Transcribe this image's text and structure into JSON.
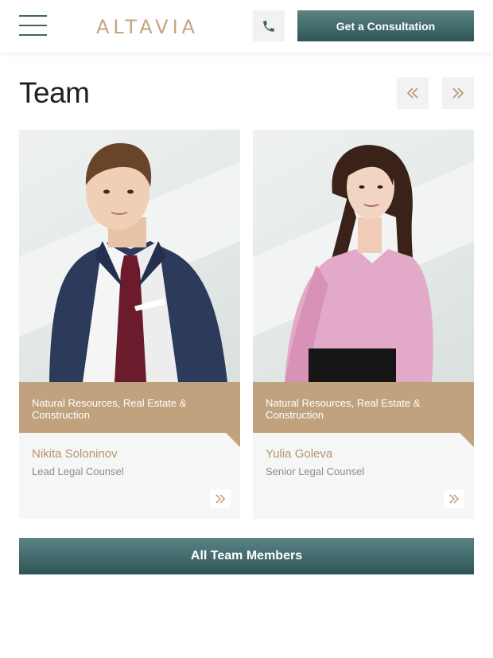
{
  "header": {
    "logo": "ALTAVIA",
    "cta_label": "Get a Consultation"
  },
  "team": {
    "title": "Team",
    "members": [
      {
        "tag": "Natural Resources, Real Estate & Construction",
        "name": "Nikita Soloninov",
        "role": "Lead Legal Counsel"
      },
      {
        "tag": "Natural Resources, Real Estate & Construction",
        "name": "Yulia Goleva",
        "role": "Senior Legal Counsel"
      }
    ],
    "all_label": "All Team Members"
  },
  "colors": {
    "accent_gold": "#c1a27f",
    "teal": "#3d6466"
  },
  "icons": [
    "menu-icon",
    "phone-icon",
    "double-chevron-left-icon",
    "double-chevron-right-icon"
  ]
}
